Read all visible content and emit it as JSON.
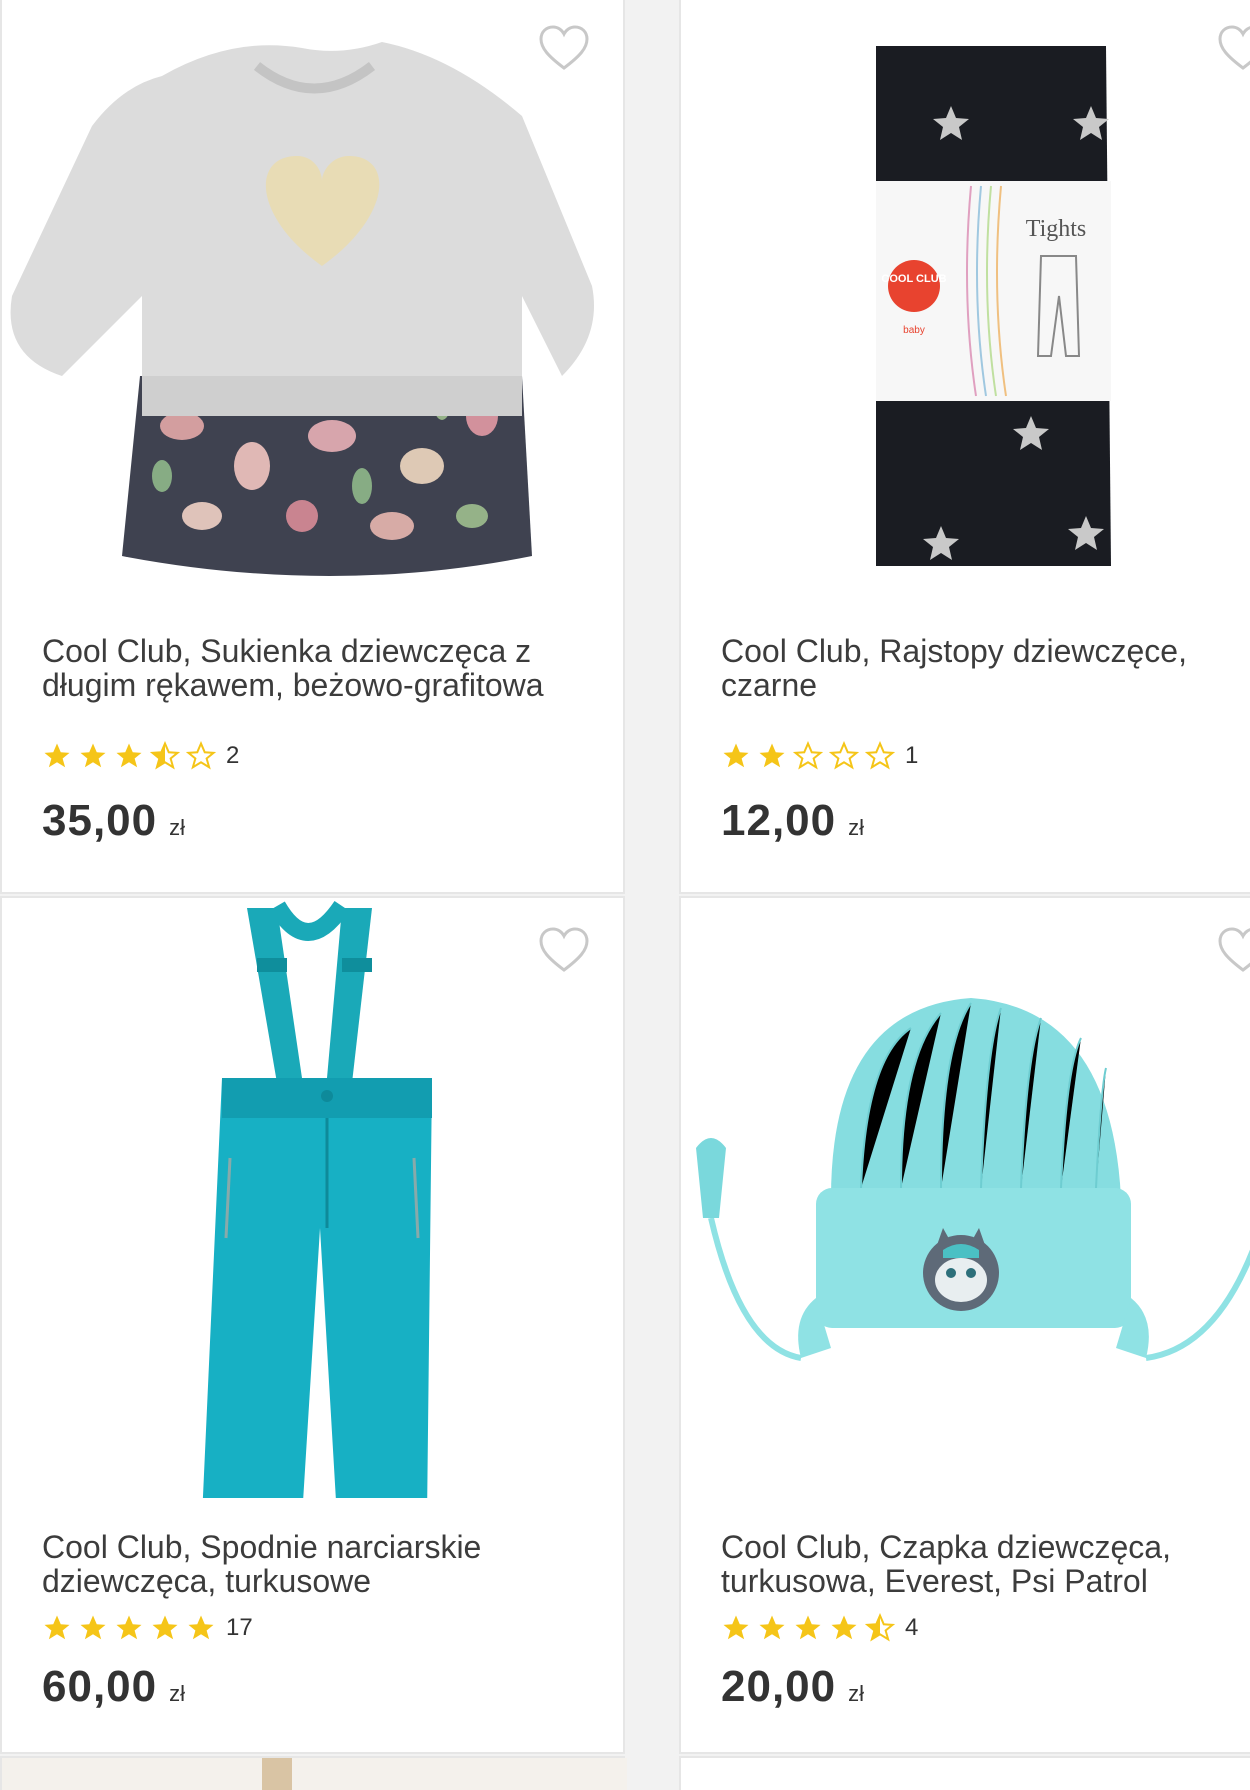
{
  "colors": {
    "star_fill": "#f5c518",
    "star_empty_stroke": "#f5c518",
    "heart_stroke": "#c8c8c8",
    "text": "#3c3c3c",
    "card_border": "#e6e6e6"
  },
  "products": [
    {
      "title": "Cool Club, Sukienka dziewczęca z długim rękawem, beżowo-grafitowa",
      "rating": 3.5,
      "rating_count": "2",
      "price": "35,00",
      "currency": "zł",
      "image_icon": "dress-image"
    },
    {
      "title": "Cool Club, Rajstopy dziewczęce, czarne",
      "rating": 2,
      "rating_count": "1",
      "price": "12,00",
      "currency": "zł",
      "image_icon": "tights-image",
      "package_text": "Tights",
      "brand_text": "COOL CLUB",
      "brand_sub": "baby"
    },
    {
      "title": "Cool Club, Spodnie narciarskie dziewczęca, turkusowe",
      "rating": 5,
      "rating_count": "17",
      "price": "60,00",
      "currency": "zł",
      "image_icon": "ski-pants-image"
    },
    {
      "title": "Cool Club, Czapka dziewczęca, turkusowa, Everest, Psi Patrol",
      "rating": 4.5,
      "rating_count": "4",
      "price": "20,00",
      "currency": "zł",
      "image_icon": "hat-image"
    }
  ]
}
